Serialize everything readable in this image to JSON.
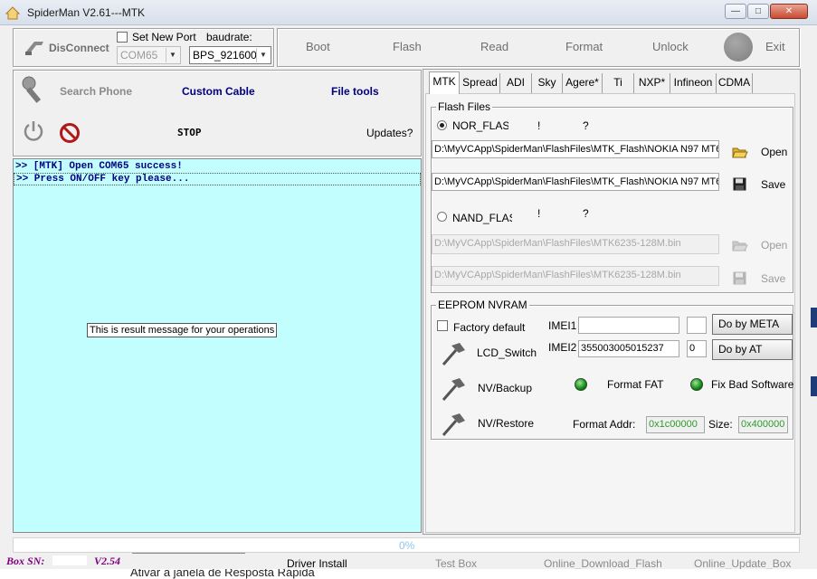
{
  "window": {
    "title": "SpiderMan V2.61---MTK"
  },
  "connection": {
    "disconnect_label": "DisConnect",
    "set_new_port_label": "Set New Port",
    "baudrate_label": "baudrate:",
    "port_value": "COM65",
    "baudrate_value": "BPS_921600"
  },
  "toolbar": {
    "boot": "Boot",
    "flash": "Flash",
    "read": "Read",
    "format": "Format",
    "unlock": "Unlock",
    "exit": "Exit"
  },
  "tools": {
    "search_phone": "Search Phone",
    "custom_cable": "Custom Cable",
    "file_tools": "File tools",
    "stop": "STOP",
    "updates": "Updates?"
  },
  "console": {
    "lines": [
      ">> [MTK] Open COM65 success!",
      ">> Press ON/OFF key please..."
    ],
    "tooltip": "This is result message for your operations"
  },
  "tabs": [
    "MTK",
    "Spread",
    "ADI",
    "Sky",
    "Agere*",
    "Ti",
    "NXP*",
    "Infineon",
    "CDMA"
  ],
  "flash_files": {
    "title": "Flash Files",
    "nor_label": "NOR_FLASH",
    "nand_label": "NAND_FLASH",
    "mark_excl": "!",
    "mark_q": "?",
    "nor_path1": "D:\\MyVCApp\\SpiderMan\\FlashFiles\\MTK_Flash\\NOKIA N97 MT6",
    "nor_path2": "D:\\MyVCApp\\SpiderMan\\FlashFiles\\MTK_Flash\\NOKIA N97 MT6",
    "nand_path1": "D:\\MyVCApp\\SpiderMan\\FlashFiles\\MTK6235-128M.bin",
    "nand_path2": "D:\\MyVCApp\\SpiderMan\\FlashFiles\\MTK6235-128M.bin",
    "open": "Open",
    "save": "Save"
  },
  "eeprom": {
    "title": "EEPROM NVRAM",
    "factory_default": "Factory default",
    "imei1_label": "IMEI1",
    "imei1_value": "",
    "imei1_index": "",
    "imei2_label": "IMEI2",
    "imei2_value": "355003005015237",
    "imei2_index": "0",
    "do_by_meta": "Do by META",
    "do_by_at": "Do by AT",
    "lcd_switch": "LCD_Switch",
    "nv_backup": "NV/Backup",
    "nv_restore": "NV/Restore",
    "format_fat": "Format FAT",
    "fix_bad_software": "Fix Bad Software",
    "format_addr_label": "Format Addr:",
    "format_addr_value": "0x1c00000",
    "size_label": "Size:",
    "size_value": "0x400000"
  },
  "status": {
    "progress_text": "0%",
    "progress": 0,
    "box_sn_label": "Box SN:",
    "version": "V2.54",
    "driver_install": "Driver Install",
    "test_box": "Test Box",
    "online_download_flash": "Online_Download_Flash",
    "online_update_box": "Online_Update_Box",
    "behind_text": "Ativar a janela de Resposta Rápida"
  },
  "colors": {
    "console_bg": "#c2fefe",
    "log_text": "#000080",
    "custom_cable": "#000080",
    "sn_label": "#800080"
  }
}
